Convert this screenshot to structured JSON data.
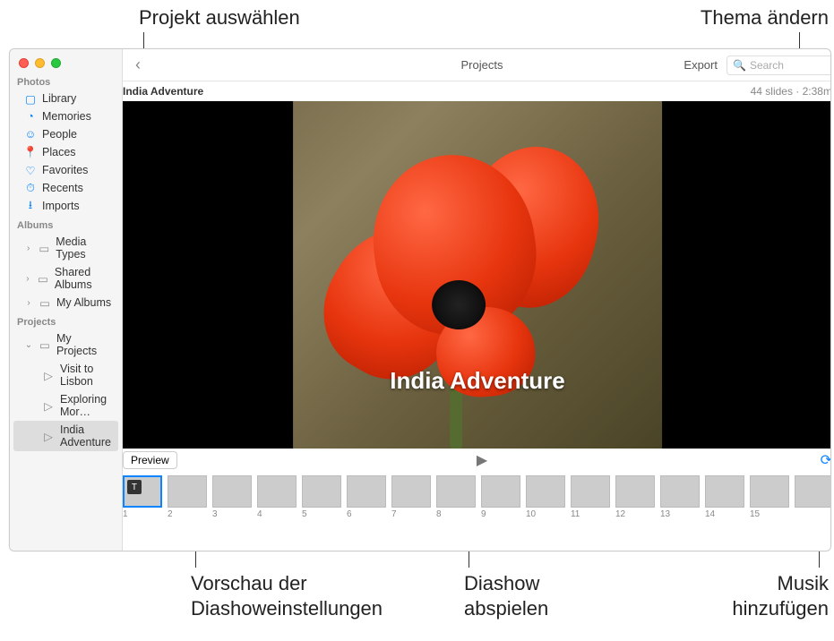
{
  "callouts": {
    "select_project": "Projekt auswählen",
    "change_theme": "Thema ändern",
    "preview_settings_l1": "Vorschau der",
    "preview_settings_l2": "Diashoweinstellungen",
    "play_slideshow_l1": "Diashow",
    "play_slideshow_l2": "abspielen",
    "add_music_l1": "Musik",
    "add_music_l2": "hinzufügen"
  },
  "toolbar": {
    "title": "Projects",
    "export": "Export",
    "search_placeholder": "Search"
  },
  "project": {
    "name": "India Adventure",
    "meta": "44 slides · 2:38m",
    "slide_title": "India Adventure"
  },
  "controls": {
    "preview": "Preview",
    "title_badge": "T"
  },
  "sidebar": {
    "photos_header": "Photos",
    "photos": [
      {
        "label": "Library"
      },
      {
        "label": "Memories"
      },
      {
        "label": "People"
      },
      {
        "label": "Places"
      },
      {
        "label": "Favorites"
      },
      {
        "label": "Recents"
      },
      {
        "label": "Imports"
      }
    ],
    "albums_header": "Albums",
    "albums": [
      {
        "label": "Media Types"
      },
      {
        "label": "Shared Albums"
      },
      {
        "label": "My Albums"
      }
    ],
    "projects_header": "Projects",
    "my_projects_label": "My Projects",
    "projects": [
      {
        "label": "Visit to Lisbon"
      },
      {
        "label": "Exploring Mor…"
      },
      {
        "label": "India Adventure"
      }
    ]
  },
  "thumbs": [
    "1",
    "2",
    "3",
    "4",
    "5",
    "6",
    "7",
    "8",
    "9",
    "10",
    "11",
    "12",
    "13",
    "14",
    "15",
    ""
  ]
}
